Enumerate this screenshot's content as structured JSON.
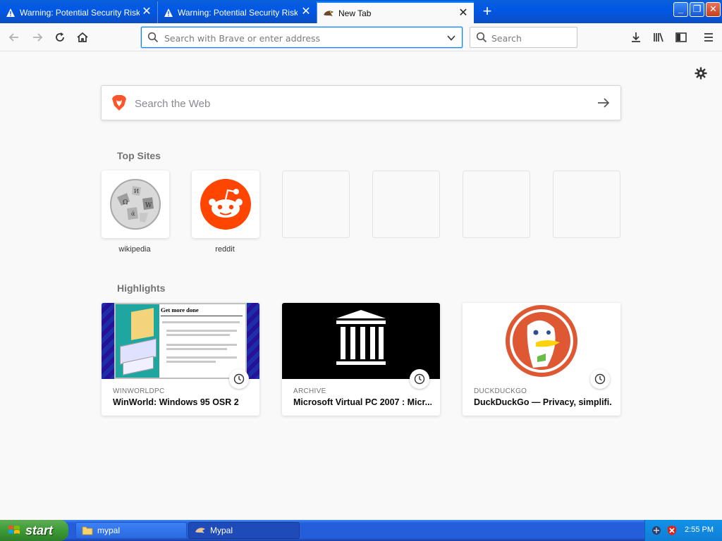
{
  "tabs": [
    {
      "title": "Warning: Potential Security Risk Ahead",
      "icon": "warning-icon",
      "active": false
    },
    {
      "title": "Warning: Potential Security Risk Ahead",
      "icon": "warning-icon",
      "active": false
    },
    {
      "title": "New Tab",
      "icon": "mypal-icon",
      "active": true
    }
  ],
  "urlbar": {
    "placeholder": "Search with Brave or enter address",
    "value": ""
  },
  "searchbar": {
    "placeholder": "Search",
    "value": ""
  },
  "websearch": {
    "placeholder": "Search the Web"
  },
  "top_sites": {
    "heading": "Top Sites",
    "sites": [
      {
        "label": "wikipedia",
        "icon": "wikipedia-icon"
      },
      {
        "label": "reddit",
        "icon": "reddit-icon"
      },
      {
        "label": "",
        "icon": ""
      },
      {
        "label": "",
        "icon": ""
      },
      {
        "label": "",
        "icon": ""
      },
      {
        "label": "",
        "icon": ""
      }
    ]
  },
  "highlights": {
    "heading": "Highlights",
    "cards": [
      {
        "source": "WINWORLDPC",
        "title": "WinWorld: Windows 95 OSR 2",
        "thumb_title": "Get more done"
      },
      {
        "source": "ARCHIVE",
        "title": "Microsoft Virtual PC 2007 : Micr..."
      },
      {
        "source": "DUCKDUCKGO",
        "title": "DuckDuckGo — Privacy, simplifi..."
      }
    ]
  },
  "taskbar": {
    "start_label": "start",
    "items": [
      {
        "label": "mypal",
        "icon": "folder-icon",
        "active": false
      },
      {
        "label": "Mypal",
        "icon": "mypal-icon",
        "active": true
      }
    ],
    "clock": "2:55 PM"
  },
  "colors": {
    "accent": "#0a84ff",
    "xp_blue": "#245edb",
    "start_green": "#3c9b34",
    "reddit": "#ff4500",
    "ddg": "#de5833"
  }
}
